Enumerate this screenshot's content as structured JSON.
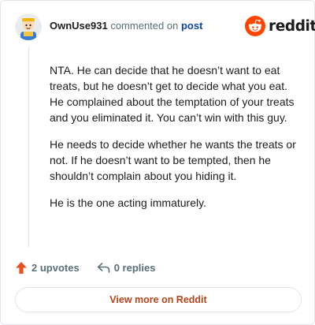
{
  "header": {
    "username": "OwnUse931",
    "action_text": "commented on",
    "post_link": "post",
    "logo_text": "reddit"
  },
  "comment": {
    "paragraphs": [
      "NTA. He can decide that he doesn’t want to eat treats, but he doesn’t get to decide what you eat. He complained about the temptation of your treats and you eliminated it. You can’t win with this guy.",
      "He needs to decide whether he wants the treats or not. If he doesn’t want to be tempted, then he shouldn’t complain about you hiding it.",
      "He is the one acting immaturely."
    ]
  },
  "actions": {
    "upvotes": "2 upvotes",
    "replies": "0 replies"
  },
  "footer": {
    "view_more_label": "View more on Reddit"
  },
  "icons": {
    "avatar": "user-avatar",
    "logo": "reddit-snoo-icon",
    "upvote": "upvote-arrow-icon",
    "reply": "reply-arrow-icon"
  },
  "colors": {
    "reddit_orange": "#ff4500",
    "upvote_orange": "#e8501d",
    "link_blue": "#0a449b",
    "view_more_text": "#b3441a",
    "muted_text": "#576f76",
    "border": "#e3e5e8"
  }
}
